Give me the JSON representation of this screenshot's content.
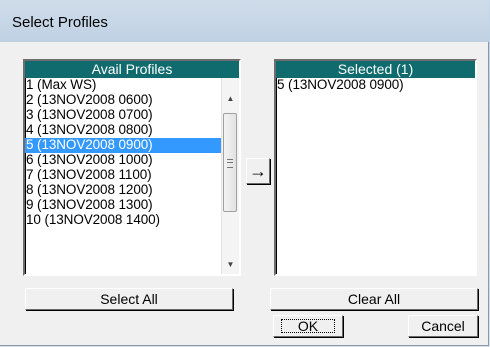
{
  "window": {
    "title": "Select Profiles"
  },
  "avail_list": {
    "header": "Avail Profiles",
    "items": [
      "1 (Max WS)",
      "2 (13NOV2008 0600)",
      "3 (13NOV2008 0700)",
      "4 (13NOV2008 0800)",
      "5 (13NOV2008 0900)",
      "6 (13NOV2008 1000)",
      "7 (13NOV2008 1100)",
      "8 (13NOV2008 1200)",
      "9 (13NOV2008 1300)",
      "10 (13NOV2008 1400)"
    ],
    "selected_index": 4
  },
  "selected_list": {
    "header": "Selected  (1)",
    "items": [
      "5 (13NOV2008 0900)"
    ]
  },
  "buttons": {
    "move_right": "→",
    "select_all": "Select All",
    "clear_all": "Clear All",
    "ok": "OK",
    "cancel": "Cancel"
  },
  "colors": {
    "header_bg": "#0f6b6e",
    "selection_bg": "#3399ff"
  }
}
